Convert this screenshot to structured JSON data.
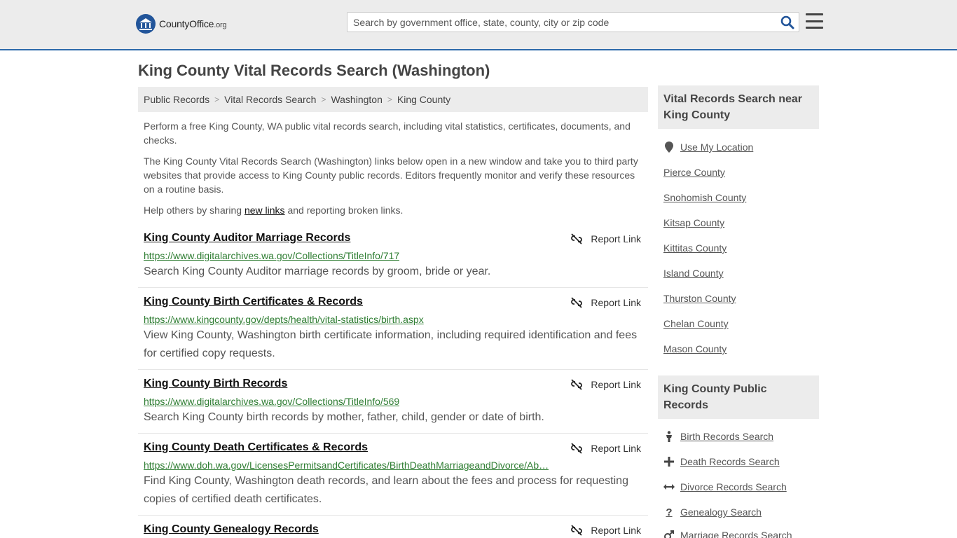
{
  "header": {
    "logo_name": "CountyOffice",
    "logo_suffix": ".org",
    "search_placeholder": "Search by government office, state, county, city or zip code",
    "accent_color": "#2d6aab"
  },
  "page_title": "King County Vital Records Search (Washington)",
  "breadcrumb": [
    "Public Records",
    "Vital Records Search",
    "Washington",
    "King County"
  ],
  "intro": {
    "p1": "Perform a free King County, WA public vital records search, including vital statistics, certificates, documents, and checks.",
    "p2": "The King County Vital Records Search (Washington) links below open in a new window and take you to third party websites that provide access to King County public records. Editors frequently monitor and verify these resources on a routine basis.",
    "p3_before": "Help others by sharing ",
    "p3_link": "new links",
    "p3_after": " and reporting broken links."
  },
  "report_label": "Report Link",
  "results": [
    {
      "title": "King County Auditor Marriage Records",
      "url": "https://www.digitalarchives.wa.gov/Collections/TitleInfo/717",
      "desc": "Search King County Auditor marriage records by groom, bride or year."
    },
    {
      "title": "King County Birth Certificates & Records",
      "url": "https://www.kingcounty.gov/depts/health/vital-statistics/birth.aspx",
      "desc": "View King County, Washington birth certificate information, including required identification and fees for certified copy requests."
    },
    {
      "title": "King County Birth Records",
      "url": "https://www.digitalarchives.wa.gov/Collections/TitleInfo/569",
      "desc": "Search King County birth records by mother, father, child, gender or date of birth."
    },
    {
      "title": "King County Death Certificates & Records",
      "url": "https://www.doh.wa.gov/LicensesPermitsandCertificates/BirthDeathMarriageandDivorce/Ab…",
      "desc": "Find King County, Washington death records, and learn about the fees and process for requesting copies of certified death certificates."
    },
    {
      "title": "King County Genealogy Records",
      "url": "",
      "desc": ""
    }
  ],
  "sidebar": {
    "nearby_heading": "Vital Records Search near King County",
    "use_location": "Use My Location",
    "nearby": [
      "Pierce County",
      "Snohomish County",
      "Kitsap County",
      "Kittitas County",
      "Island County",
      "Thurston County",
      "Chelan County",
      "Mason County"
    ],
    "public_heading": "King County Public Records",
    "public_links": [
      {
        "label": "Birth Records Search",
        "icon": "person-icon"
      },
      {
        "label": "Death Records Search",
        "icon": "cross-icon"
      },
      {
        "label": "Divorce Records Search",
        "icon": "split-arrows-icon"
      },
      {
        "label": "Genealogy Search",
        "icon": "question-icon"
      },
      {
        "label": "Marriage Records Search",
        "icon": "gender-icon"
      }
    ]
  }
}
